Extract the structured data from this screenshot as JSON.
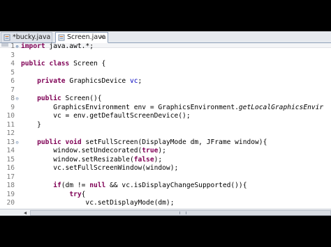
{
  "tabs": [
    {
      "label": "*bucky.java",
      "icon": "java-file-icon",
      "active": false
    },
    {
      "label": "Screen.java",
      "icon": "java-file-icon",
      "active": true,
      "close": "✕"
    }
  ],
  "editor": {
    "colors": {
      "keyword": "#7f0055",
      "field": "#0000c0",
      "line_number": "#7a7a7a"
    },
    "lines": [
      {
        "n": "1",
        "fold": "⊕",
        "code": "import java.awt.*;"
      },
      {
        "n": "3",
        "code": ""
      },
      {
        "n": "4",
        "code": "public class Screen {"
      },
      {
        "n": "5",
        "code": ""
      },
      {
        "n": "6",
        "code": "    private GraphicsDevice vc;"
      },
      {
        "n": "7",
        "code": ""
      },
      {
        "n": "8",
        "fold": "⊝",
        "code": "    public Screen(){"
      },
      {
        "n": "9",
        "code": "        GraphicsEnvironment env = GraphicsEnvironment.getLocalGraphicsEnvir"
      },
      {
        "n": "10",
        "code": "        vc = env.getDefaultScreenDevice();"
      },
      {
        "n": "11",
        "code": "    }"
      },
      {
        "n": "12",
        "code": ""
      },
      {
        "n": "13",
        "fold": "⊝",
        "code": "    public void setFullScreen(DisplayMode dm, JFrame window){"
      },
      {
        "n": "14",
        "code": "        window.setUndecorated(true);"
      },
      {
        "n": "15",
        "code": "        window.setResizable(false);"
      },
      {
        "n": "16",
        "code": "        vc.setFullScreenWindow(window);"
      },
      {
        "n": "17",
        "code": ""
      },
      {
        "n": "18",
        "code": "        if(dm != null && vc.isDisplayChangeSupported()){"
      },
      {
        "n": "19",
        "code": "            try{"
      },
      {
        "n": "20",
        "code": "                vc.setDisplayMode(dm);"
      }
    ]
  }
}
